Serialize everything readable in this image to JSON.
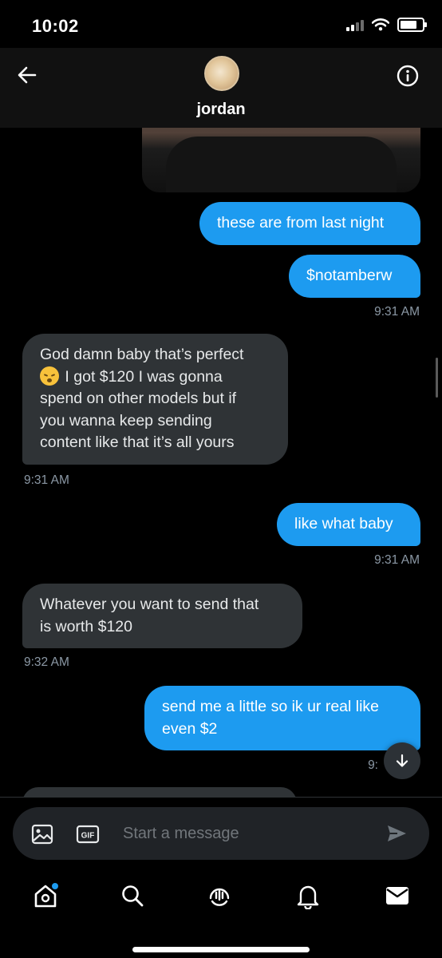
{
  "status_bar": {
    "time": "10:02"
  },
  "header": {
    "contact_name": "jordan"
  },
  "messages": [
    {
      "text_lines": [
        "these are from last night"
      ]
    },
    {
      "text_lines": [
        "$notamberw"
      ],
      "time": "9:31 AM"
    },
    {
      "text_lines": [
        "God damn baby that’s perfect",
        "I got $120 I was gonna",
        "spend on other models but if",
        "you wanna keep sending",
        "content like that it’s all yours"
      ],
      "time": "9:31 AM"
    },
    {
      "text_lines": [
        "like what baby"
      ],
      "time": "9:31 AM"
    },
    {
      "text_lines": [
        "Whatever you want to send that",
        "is worth $120"
      ],
      "time": "9:32 AM"
    },
    {
      "text_lines": [
        "send me a little so ik ur real like",
        "even $2"
      ],
      "time": "9:"
    }
  ],
  "composer": {
    "placeholder": "Start a message",
    "gif_label": "GIF"
  },
  "icons": [
    "back-arrow-icon",
    "info-icon",
    "image-icon",
    "gif-icon",
    "send-icon",
    "home-icon",
    "search-icon",
    "spaces-icon",
    "notifications-icon",
    "messages-icon",
    "chevron-down-icon"
  ],
  "colors": {
    "outgoing_bubble": "#1d9bf0",
    "incoming_bubble": "#2f3336",
    "timestamp": "#8b98a5",
    "background": "#000000"
  }
}
